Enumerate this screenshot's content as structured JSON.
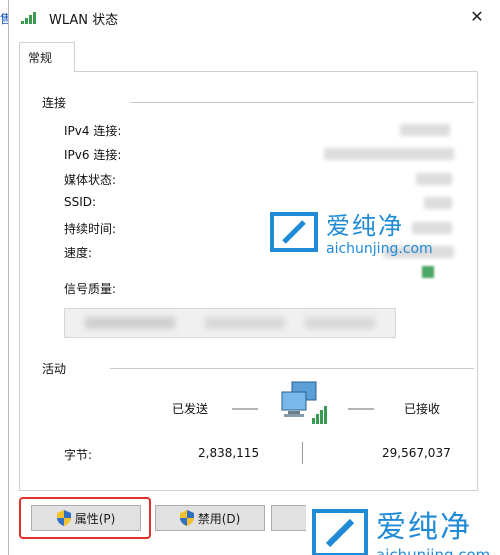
{
  "behind_window": {
    "fragment": "售"
  },
  "window": {
    "title": "WLAN 状态",
    "close_glyph": "✕"
  },
  "tabs": [
    {
      "label": "常规"
    }
  ],
  "connection": {
    "group_label": "连接",
    "rows": [
      {
        "label": "IPv4 连接:"
      },
      {
        "label": "IPv6 连接:"
      },
      {
        "label": "媒体状态:"
      },
      {
        "label": "SSID:"
      },
      {
        "label": "持续时间:"
      },
      {
        "label": "速度:"
      }
    ],
    "signal_label": "信号质量:"
  },
  "activity": {
    "group_label": "活动",
    "sent_label": "已发送",
    "received_label": "已接收",
    "bytes_label": "字节:",
    "bytes_sent": "2,838,115",
    "bytes_received": "29,567,037"
  },
  "buttons": {
    "properties": "属性(P)",
    "disable": "禁用(D)"
  },
  "watermark": {
    "name": "爱纯净",
    "url": "aichunjing.com"
  },
  "colors": {
    "highlight": "#e0302a",
    "watermark": "#1f8ad6",
    "signal": "#4da566"
  }
}
